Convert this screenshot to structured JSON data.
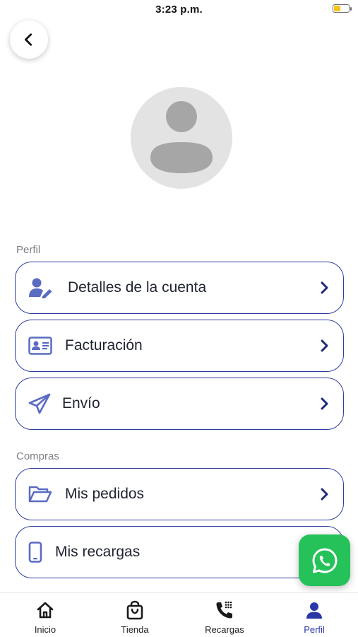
{
  "status_bar": {
    "time": "3:23 p.m.",
    "battery_level": 0.45,
    "battery_color": "#f5c518"
  },
  "colors": {
    "accent": "#2f3e9e",
    "icon": "#5a6bc2",
    "whatsapp": "#25c25a",
    "active_tab": "#2a37a6"
  },
  "header": {
    "back_icon": "chevron-left-icon"
  },
  "profile": {
    "avatar_icon": "user-placeholder-icon"
  },
  "sections": {
    "perfil": {
      "title": "Perfil",
      "items": [
        {
          "label": "Detalles de la cuenta",
          "icon": "user-edit-icon"
        },
        {
          "label": "Facturación",
          "icon": "id-card-icon"
        },
        {
          "label": "Envío",
          "icon": "paper-plane-icon"
        }
      ]
    },
    "compras": {
      "title": "Compras",
      "items": [
        {
          "label": "Mis pedidos",
          "icon": "folder-open-icon"
        },
        {
          "label": "Mis recargas",
          "icon": "mobile-phone-icon"
        }
      ]
    }
  },
  "fab": {
    "icon": "whatsapp-icon"
  },
  "tabbar": {
    "items": [
      {
        "label": "Inicio",
        "icon": "home-icon"
      },
      {
        "label": "Tienda",
        "icon": "shopping-bag-icon"
      },
      {
        "label": "Recargas",
        "icon": "phone-keypad-icon"
      },
      {
        "label": "Perfil",
        "icon": "user-icon"
      }
    ],
    "active": "Perfil"
  }
}
